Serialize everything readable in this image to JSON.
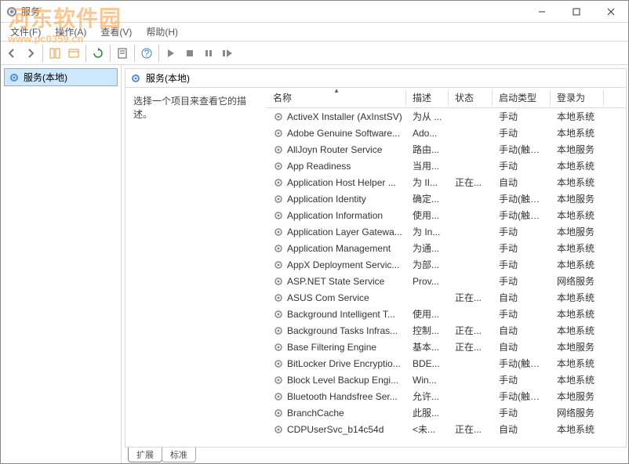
{
  "window": {
    "title": "服务"
  },
  "menubar": {
    "file": "文件(F)",
    "action": "操作(A)",
    "view": "查看(V)",
    "help": "帮助(H)"
  },
  "nav": {
    "local_services": "服务(本地)"
  },
  "panel": {
    "header": "服务(本地)",
    "desc_prompt": "选择一个项目来查看它的描述。"
  },
  "columns": {
    "name": "名称",
    "desc": "描述",
    "status": "状态",
    "startup": "启动类型",
    "logon": "登录为"
  },
  "tabs": {
    "extended": "扩展",
    "standard": "标准"
  },
  "watermark": {
    "line1": "河东软件园",
    "line2": "www.pc0359.cn"
  },
  "services": [
    {
      "name": "ActiveX Installer (AxInstSV)",
      "desc": "为从 ...",
      "status": "",
      "startup": "手动",
      "logon": "本地系统"
    },
    {
      "name": "Adobe Genuine Software...",
      "desc": "Ado...",
      "status": "",
      "startup": "手动",
      "logon": "本地系统"
    },
    {
      "name": "AllJoyn Router Service",
      "desc": "路由...",
      "status": "",
      "startup": "手动(触发...",
      "logon": "本地服务"
    },
    {
      "name": "App Readiness",
      "desc": "当用...",
      "status": "",
      "startup": "手动",
      "logon": "本地系统"
    },
    {
      "name": "Application Host Helper ...",
      "desc": "为 II...",
      "status": "正在...",
      "startup": "自动",
      "logon": "本地系统"
    },
    {
      "name": "Application Identity",
      "desc": "确定...",
      "status": "",
      "startup": "手动(触发...",
      "logon": "本地服务"
    },
    {
      "name": "Application Information",
      "desc": "使用...",
      "status": "",
      "startup": "手动(触发...",
      "logon": "本地系统"
    },
    {
      "name": "Application Layer Gatewa...",
      "desc": "为 In...",
      "status": "",
      "startup": "手动",
      "logon": "本地服务"
    },
    {
      "name": "Application Management",
      "desc": "为通...",
      "status": "",
      "startup": "手动",
      "logon": "本地系统"
    },
    {
      "name": "AppX Deployment Servic...",
      "desc": "为部...",
      "status": "",
      "startup": "手动",
      "logon": "本地系统"
    },
    {
      "name": "ASP.NET State Service",
      "desc": "Prov...",
      "status": "",
      "startup": "手动",
      "logon": "网络服务"
    },
    {
      "name": "ASUS Com Service",
      "desc": "",
      "status": "正在...",
      "startup": "自动",
      "logon": "本地系统"
    },
    {
      "name": "Background Intelligent T...",
      "desc": "使用...",
      "status": "",
      "startup": "手动",
      "logon": "本地系统"
    },
    {
      "name": "Background Tasks Infras...",
      "desc": "控制...",
      "status": "正在...",
      "startup": "自动",
      "logon": "本地系统"
    },
    {
      "name": "Base Filtering Engine",
      "desc": "基本...",
      "status": "正在...",
      "startup": "自动",
      "logon": "本地服务"
    },
    {
      "name": "BitLocker Drive Encryptio...",
      "desc": "BDE...",
      "status": "",
      "startup": "手动(触发...",
      "logon": "本地系统"
    },
    {
      "name": "Block Level Backup Engi...",
      "desc": "Win...",
      "status": "",
      "startup": "手动",
      "logon": "本地系统"
    },
    {
      "name": "Bluetooth Handsfree Ser...",
      "desc": "允许...",
      "status": "",
      "startup": "手动(触发...",
      "logon": "本地服务"
    },
    {
      "name": "BranchCache",
      "desc": "此服...",
      "status": "",
      "startup": "手动",
      "logon": "网络服务"
    },
    {
      "name": "CDPUserSvc_b14c54d",
      "desc": "<未...",
      "status": "正在...",
      "startup": "自动",
      "logon": "本地系统"
    }
  ]
}
